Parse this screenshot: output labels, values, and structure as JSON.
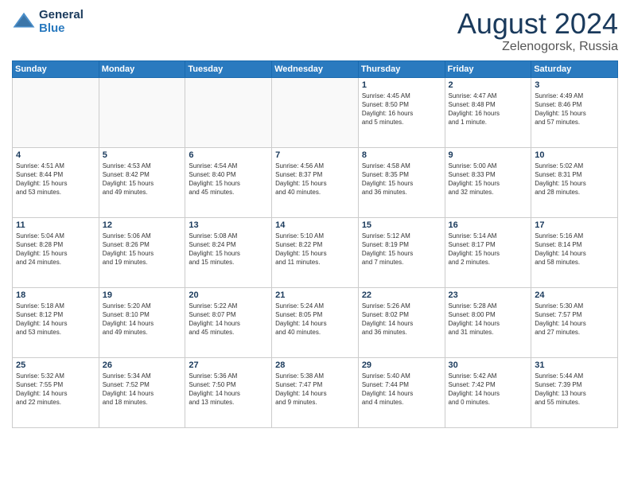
{
  "logo": {
    "general": "General",
    "blue": "Blue"
  },
  "title": {
    "month_year": "August 2024",
    "location": "Zelenogorsk, Russia"
  },
  "headers": [
    "Sunday",
    "Monday",
    "Tuesday",
    "Wednesday",
    "Thursday",
    "Friday",
    "Saturday"
  ],
  "weeks": [
    [
      {
        "day": "",
        "info": "",
        "empty": true
      },
      {
        "day": "",
        "info": "",
        "empty": true
      },
      {
        "day": "",
        "info": "",
        "empty": true
      },
      {
        "day": "",
        "info": "",
        "empty": true
      },
      {
        "day": "1",
        "info": "Sunrise: 4:45 AM\nSunset: 8:50 PM\nDaylight: 16 hours\nand 5 minutes.",
        "empty": false
      },
      {
        "day": "2",
        "info": "Sunrise: 4:47 AM\nSunset: 8:48 PM\nDaylight: 16 hours\nand 1 minute.",
        "empty": false
      },
      {
        "day": "3",
        "info": "Sunrise: 4:49 AM\nSunset: 8:46 PM\nDaylight: 15 hours\nand 57 minutes.",
        "empty": false
      }
    ],
    [
      {
        "day": "4",
        "info": "Sunrise: 4:51 AM\nSunset: 8:44 PM\nDaylight: 15 hours\nand 53 minutes.",
        "empty": false
      },
      {
        "day": "5",
        "info": "Sunrise: 4:53 AM\nSunset: 8:42 PM\nDaylight: 15 hours\nand 49 minutes.",
        "empty": false
      },
      {
        "day": "6",
        "info": "Sunrise: 4:54 AM\nSunset: 8:40 PM\nDaylight: 15 hours\nand 45 minutes.",
        "empty": false
      },
      {
        "day": "7",
        "info": "Sunrise: 4:56 AM\nSunset: 8:37 PM\nDaylight: 15 hours\nand 40 minutes.",
        "empty": false
      },
      {
        "day": "8",
        "info": "Sunrise: 4:58 AM\nSunset: 8:35 PM\nDaylight: 15 hours\nand 36 minutes.",
        "empty": false
      },
      {
        "day": "9",
        "info": "Sunrise: 5:00 AM\nSunset: 8:33 PM\nDaylight: 15 hours\nand 32 minutes.",
        "empty": false
      },
      {
        "day": "10",
        "info": "Sunrise: 5:02 AM\nSunset: 8:31 PM\nDaylight: 15 hours\nand 28 minutes.",
        "empty": false
      }
    ],
    [
      {
        "day": "11",
        "info": "Sunrise: 5:04 AM\nSunset: 8:28 PM\nDaylight: 15 hours\nand 24 minutes.",
        "empty": false
      },
      {
        "day": "12",
        "info": "Sunrise: 5:06 AM\nSunset: 8:26 PM\nDaylight: 15 hours\nand 19 minutes.",
        "empty": false
      },
      {
        "day": "13",
        "info": "Sunrise: 5:08 AM\nSunset: 8:24 PM\nDaylight: 15 hours\nand 15 minutes.",
        "empty": false
      },
      {
        "day": "14",
        "info": "Sunrise: 5:10 AM\nSunset: 8:22 PM\nDaylight: 15 hours\nand 11 minutes.",
        "empty": false
      },
      {
        "day": "15",
        "info": "Sunrise: 5:12 AM\nSunset: 8:19 PM\nDaylight: 15 hours\nand 7 minutes.",
        "empty": false
      },
      {
        "day": "16",
        "info": "Sunrise: 5:14 AM\nSunset: 8:17 PM\nDaylight: 15 hours\nand 2 minutes.",
        "empty": false
      },
      {
        "day": "17",
        "info": "Sunrise: 5:16 AM\nSunset: 8:14 PM\nDaylight: 14 hours\nand 58 minutes.",
        "empty": false
      }
    ],
    [
      {
        "day": "18",
        "info": "Sunrise: 5:18 AM\nSunset: 8:12 PM\nDaylight: 14 hours\nand 53 minutes.",
        "empty": false
      },
      {
        "day": "19",
        "info": "Sunrise: 5:20 AM\nSunset: 8:10 PM\nDaylight: 14 hours\nand 49 minutes.",
        "empty": false
      },
      {
        "day": "20",
        "info": "Sunrise: 5:22 AM\nSunset: 8:07 PM\nDaylight: 14 hours\nand 45 minutes.",
        "empty": false
      },
      {
        "day": "21",
        "info": "Sunrise: 5:24 AM\nSunset: 8:05 PM\nDaylight: 14 hours\nand 40 minutes.",
        "empty": false
      },
      {
        "day": "22",
        "info": "Sunrise: 5:26 AM\nSunset: 8:02 PM\nDaylight: 14 hours\nand 36 minutes.",
        "empty": false
      },
      {
        "day": "23",
        "info": "Sunrise: 5:28 AM\nSunset: 8:00 PM\nDaylight: 14 hours\nand 31 minutes.",
        "empty": false
      },
      {
        "day": "24",
        "info": "Sunrise: 5:30 AM\nSunset: 7:57 PM\nDaylight: 14 hours\nand 27 minutes.",
        "empty": false
      }
    ],
    [
      {
        "day": "25",
        "info": "Sunrise: 5:32 AM\nSunset: 7:55 PM\nDaylight: 14 hours\nand 22 minutes.",
        "empty": false
      },
      {
        "day": "26",
        "info": "Sunrise: 5:34 AM\nSunset: 7:52 PM\nDaylight: 14 hours\nand 18 minutes.",
        "empty": false
      },
      {
        "day": "27",
        "info": "Sunrise: 5:36 AM\nSunset: 7:50 PM\nDaylight: 14 hours\nand 13 minutes.",
        "empty": false
      },
      {
        "day": "28",
        "info": "Sunrise: 5:38 AM\nSunset: 7:47 PM\nDaylight: 14 hours\nand 9 minutes.",
        "empty": false
      },
      {
        "day": "29",
        "info": "Sunrise: 5:40 AM\nSunset: 7:44 PM\nDaylight: 14 hours\nand 4 minutes.",
        "empty": false
      },
      {
        "day": "30",
        "info": "Sunrise: 5:42 AM\nSunset: 7:42 PM\nDaylight: 14 hours\nand 0 minutes.",
        "empty": false
      },
      {
        "day": "31",
        "info": "Sunrise: 5:44 AM\nSunset: 7:39 PM\nDaylight: 13 hours\nand 55 minutes.",
        "empty": false
      }
    ]
  ]
}
